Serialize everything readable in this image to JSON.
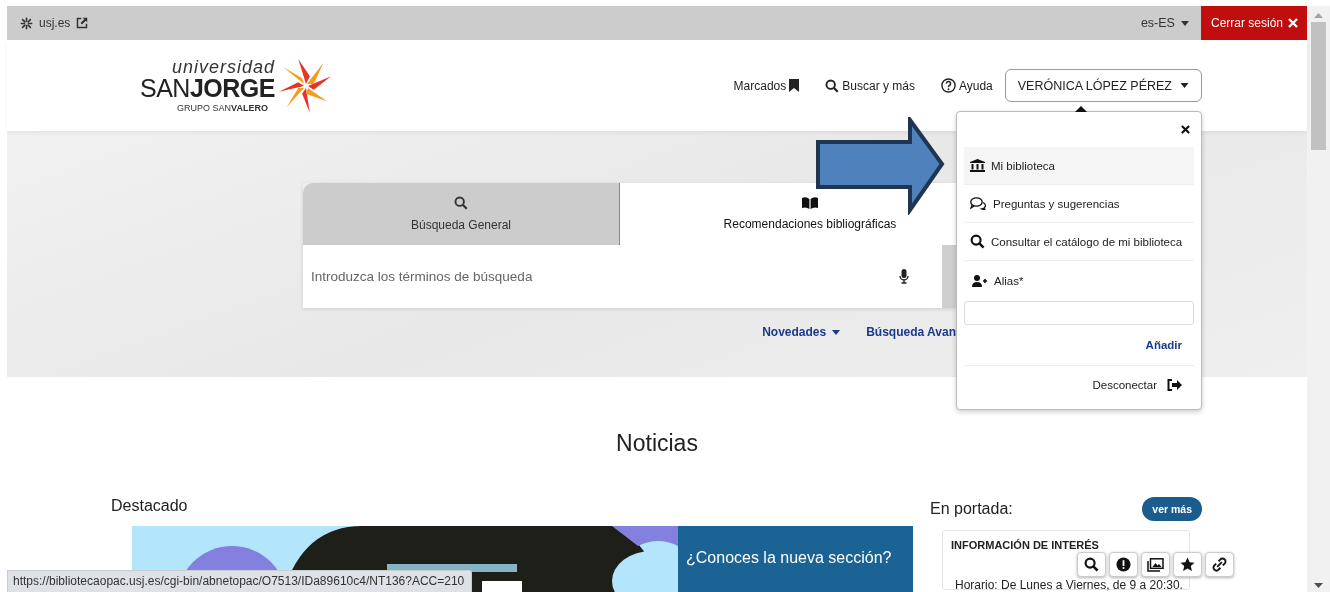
{
  "topbar": {
    "site_link": "usj.es",
    "language": "es-ES",
    "logout": "Cerrar sesión"
  },
  "logo": {
    "line1": "universidad",
    "name_light": "SAN",
    "name_bold": "JORGE",
    "group_light": "GRUPO SAN",
    "group_bold": "VALERO"
  },
  "nav": [
    {
      "kind": "bookmark",
      "label": "Marcados"
    },
    {
      "kind": "search",
      "label": "Buscar y más"
    },
    {
      "kind": "help",
      "label": "Ayuda"
    }
  ],
  "user_menu": {
    "label": "VERÓNICA LÓPEZ PÉREZ",
    "expanded": true,
    "items": [
      {
        "kind": "library",
        "label": "Mi biblioteca",
        "selected": true
      },
      {
        "kind": "chat",
        "label": "Preguntas y sugerencias",
        "selected": false
      },
      {
        "kind": "search",
        "label": "Consultar el catálogo de mi biblioteca",
        "selected": false
      }
    ],
    "alias_label": "Alias*",
    "add": "Añadir",
    "logout": "Desconectar"
  },
  "search": {
    "tabs": [
      {
        "kind": "search",
        "label": "Búsqueda General",
        "selected": false
      },
      {
        "kind": "book",
        "label": "Recomendaciones bibliográficas",
        "selected": true
      }
    ],
    "placeholder": "Introduzca los términos de búsqueda",
    "links": [
      {
        "label": "Novedades",
        "dropdown": true
      },
      {
        "label": "Búsqueda Avan",
        "dropdown": false
      }
    ]
  },
  "news": {
    "title": "Noticias",
    "featured_title": "Destacado",
    "featured_caption": "¿Conoces la nueva sección?",
    "sidebar_title": "En portada:",
    "more": "ver más",
    "card_title": "INFORMACIÓN DE INTERÉS",
    "card_text": "Horario: De Lunes a Viernes, de 9 a 20:30."
  },
  "floating_tools": [
    {
      "kind": "search"
    },
    {
      "kind": "alert"
    },
    {
      "kind": "images"
    },
    {
      "kind": "star"
    },
    {
      "kind": "link"
    }
  ],
  "status_url": "https://bibliotecaopac.usj.es/cgi-bin/abnetopac/O7513/IDa89610c4/NT136?ACC=210"
}
